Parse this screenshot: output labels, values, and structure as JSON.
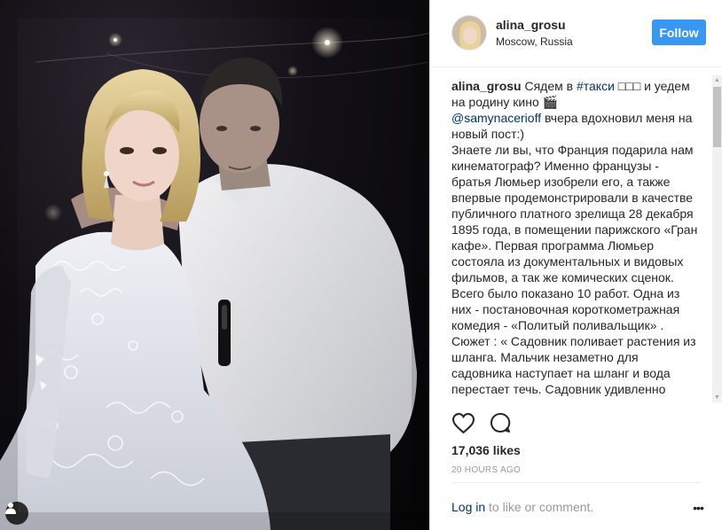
{
  "post": {
    "username": "alina_grosu",
    "location": "Moscow, Russia",
    "follow_label": "Follow",
    "caption": {
      "author": "alina_grosu",
      "lines_part1_pre": "Сядем в ",
      "hashtag": "#такси",
      "emoji_boxes": " □□□ ",
      "lines_part1_post": "и уедем на родину кино 🎬",
      "mention": "@samynacerioff",
      "mention_rest": " вчера вдохновил меня на новый пост:)",
      "body": "Знаете ли вы, что Франция подарила нам кинематограф? Именно французы - братья Люмьер изобрели его, а также впервые продемонстрировали в качестве публичного платного зрелища 28 декабря 1895 года, в помещении парижского «Гран кафе». Первая программа Люмьер состояла из документальных и видовых фильмов, а так же комических сценок. Всего было показано 10 работ. Одна из них - постановочная короткометражная комедия - «Политый поливальщик» . Сюжет : « Садовник поливает растения из шланга. Мальчик незаметно для садовника наступает на шланг и вода перестает течь. Садовник удивленно"
    },
    "likes_text": "17,036 likes",
    "time_text": "20 HOURS AGO",
    "login_link": "Log in",
    "login_rest": " to like or comment.",
    "more_label": "•••"
  },
  "icons": {
    "like": "heart-icon",
    "comment": "comment-icon",
    "tag": "person-tag-icon",
    "more": "more-options-icon"
  },
  "colors": {
    "accent": "#3897f0",
    "link": "#003569",
    "muted": "#999999",
    "text": "#262626"
  }
}
